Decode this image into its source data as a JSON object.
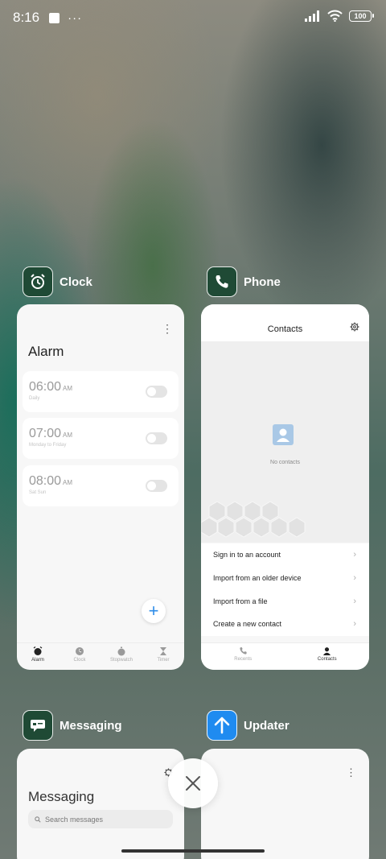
{
  "status": {
    "time": "8:16",
    "more": "···",
    "battery": "100"
  },
  "apps": {
    "clock": {
      "name": "Clock",
      "title": "Alarm",
      "alarms": [
        {
          "time": "06:00",
          "ampm": "AM",
          "repeat": "Daily"
        },
        {
          "time": "07:00",
          "ampm": "AM",
          "repeat": "Monday to Friday"
        },
        {
          "time": "08:00",
          "ampm": "AM",
          "repeat": "Sat Sun"
        }
      ],
      "tabs": [
        "Alarm",
        "Clock",
        "Stopwatch",
        "Timer"
      ]
    },
    "phone": {
      "name": "Phone",
      "title": "Contacts",
      "empty": "No contacts",
      "actions": [
        "Sign in to an account",
        "Import from an older device",
        "Import from a file",
        "Create a new contact"
      ],
      "tabs": [
        "Recents",
        "Contacts"
      ]
    },
    "messaging": {
      "name": "Messaging",
      "title": "Messaging",
      "search_placeholder": "Search messages"
    },
    "updater": {
      "name": "Updater"
    }
  },
  "colors": {
    "accent": "#2d8ce8",
    "app_icon_green": "#1f4a35",
    "updater_blue": "#1f8bf0"
  }
}
